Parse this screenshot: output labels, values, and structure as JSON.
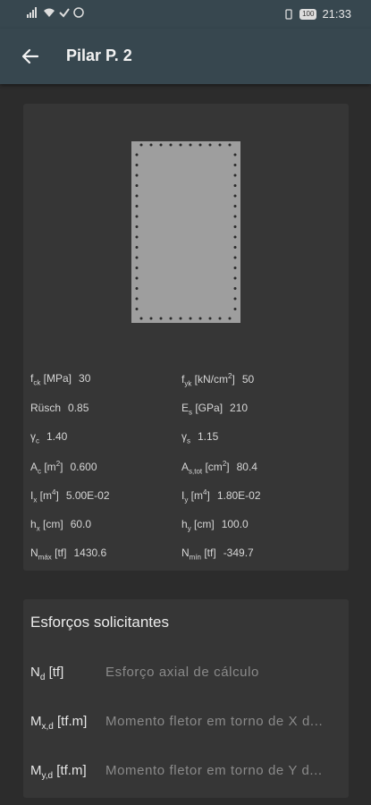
{
  "status": {
    "time": "21:33",
    "battery": "100"
  },
  "appbar": {
    "title": "Pilar P. 2"
  },
  "props": [
    {
      "sym": "f",
      "sub": "ck",
      "unit_pre": " [MPa]",
      "sup": "",
      "unit_post": "",
      "value": "30"
    },
    {
      "sym": "f",
      "sub": "yk",
      "unit_pre": " [kN/cm",
      "sup": "2",
      "unit_post": "]",
      "value": "50"
    },
    {
      "sym": "Rüsch",
      "sub": "",
      "unit_pre": "",
      "sup": "",
      "unit_post": "",
      "value": "0.85"
    },
    {
      "sym": "E",
      "sub": "s",
      "unit_pre": " [GPa]",
      "sup": "",
      "unit_post": "",
      "value": "210"
    },
    {
      "sym": "γ",
      "sub": "c",
      "unit_pre": "",
      "sup": "",
      "unit_post": "",
      "value": "1.40"
    },
    {
      "sym": "γ",
      "sub": "s",
      "unit_pre": "",
      "sup": "",
      "unit_post": "",
      "value": "1.15"
    },
    {
      "sym": "A",
      "sub": "c",
      "unit_pre": " [m",
      "sup": "2",
      "unit_post": "]",
      "value": "0.600"
    },
    {
      "sym": "A",
      "sub": "s,tot",
      "unit_pre": " [cm",
      "sup": "2",
      "unit_post": "]",
      "value": "80.4"
    },
    {
      "sym": "I",
      "sub": "x",
      "unit_pre": " [m",
      "sup": "4",
      "unit_post": "]",
      "value": "5.00E-02"
    },
    {
      "sym": "I",
      "sub": "y",
      "unit_pre": " [m",
      "sup": "4",
      "unit_post": "]",
      "value": "1.80E-02"
    },
    {
      "sym": "h",
      "sub": "x",
      "unit_pre": " [cm]",
      "sup": "",
      "unit_post": "",
      "value": "60.0"
    },
    {
      "sym": "h",
      "sub": "y",
      "unit_pre": " [cm]",
      "sup": "",
      "unit_post": "",
      "value": "100.0"
    },
    {
      "sym": "N",
      "sub": "máx",
      "unit_pre": " [tf]",
      "sup": "",
      "unit_post": "",
      "value": "1430.6"
    },
    {
      "sym": "N",
      "sub": "mín",
      "unit_pre": " [tf]",
      "sup": "",
      "unit_post": "",
      "value": "-349.7"
    }
  ],
  "forces": {
    "title": "Esforços solicitantes",
    "rows": [
      {
        "sym": "N",
        "sub": "d",
        "unit": " [tf]",
        "desc": "Esforço axial de cálculo"
      },
      {
        "sym": "M",
        "sub": "x,d",
        "unit": " [tf.m]",
        "desc": "Momento fletor em torno de X d..."
      },
      {
        "sym": "M",
        "sub": "y,d",
        "unit": " [tf.m]",
        "desc": "Momento fletor em torno de Y d..."
      }
    ]
  },
  "colors": {
    "appbar": "#37474f",
    "background": "#2c2c2c",
    "card": "#363636",
    "section_fill": "#9e9e9e"
  }
}
